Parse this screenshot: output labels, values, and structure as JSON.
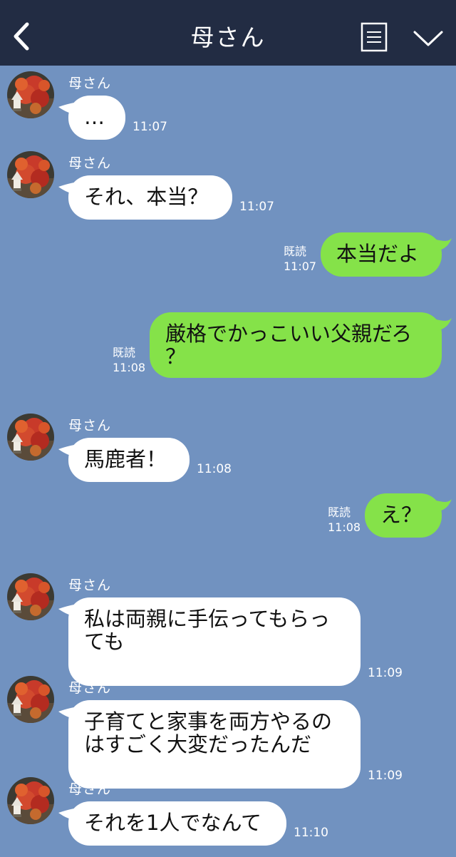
{
  "header": {
    "title": "母さん"
  },
  "icons": {
    "back": "chevron-left-icon",
    "menu": "menu-icon",
    "collapse": "chevron-down-icon"
  },
  "colors": {
    "header_bg": "#222c43",
    "chat_bg": "#7192c0",
    "outgoing_bubble": "#85e249",
    "incoming_bubble": "#ffffff"
  },
  "messages": [
    {
      "side": "in",
      "sender": "母さん",
      "lines": [
        "…"
      ],
      "time": "11:07"
    },
    {
      "side": "in",
      "sender": "母さん",
      "lines": [
        "それ、本当？"
      ],
      "time": "11:07"
    },
    {
      "side": "out",
      "lines": [
        "本当だよ"
      ],
      "read": "既読",
      "time": "11:07"
    },
    {
      "side": "out",
      "lines": [
        "厳格でかっこいい父親だろ",
        "？"
      ],
      "read": "既読",
      "time": "11:08"
    },
    {
      "side": "in",
      "sender": "母さん",
      "lines": [
        "馬鹿者！"
      ],
      "time": "11:08"
    },
    {
      "side": "out",
      "lines": [
        "え？"
      ],
      "read": "既読",
      "time": "11:08"
    },
    {
      "side": "in",
      "sender": "母さん",
      "lines": [
        "私は両親に手伝ってもらっ",
        "ても"
      ],
      "time": "11:09"
    },
    {
      "side": "in",
      "sender": "母さん",
      "lines": [
        "子育てと家事を両方やるの",
        "はすごく大変だったんだ"
      ],
      "time": "11:09"
    },
    {
      "side": "in",
      "sender": "母さん",
      "lines": [
        "それを1人でなんて"
      ],
      "time": "11:10"
    }
  ]
}
